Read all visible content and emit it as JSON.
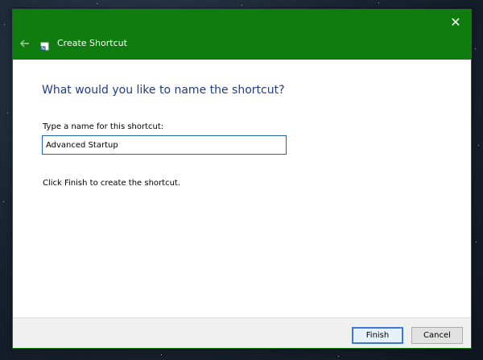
{
  "window": {
    "title": "Create Shortcut",
    "close_glyph": "✕",
    "accent_color": "#107c10"
  },
  "wizard": {
    "heading": "What would you like to name the shortcut?",
    "field_label": "Type a name for this shortcut:",
    "name_value": "Advanced Startup",
    "hint": "Click Finish to create the shortcut."
  },
  "footer": {
    "finish_label": "Finish",
    "cancel_label": "Cancel"
  },
  "icons": {
    "back": "back-arrow-icon",
    "app": "shortcut-icon",
    "close": "close-icon"
  }
}
